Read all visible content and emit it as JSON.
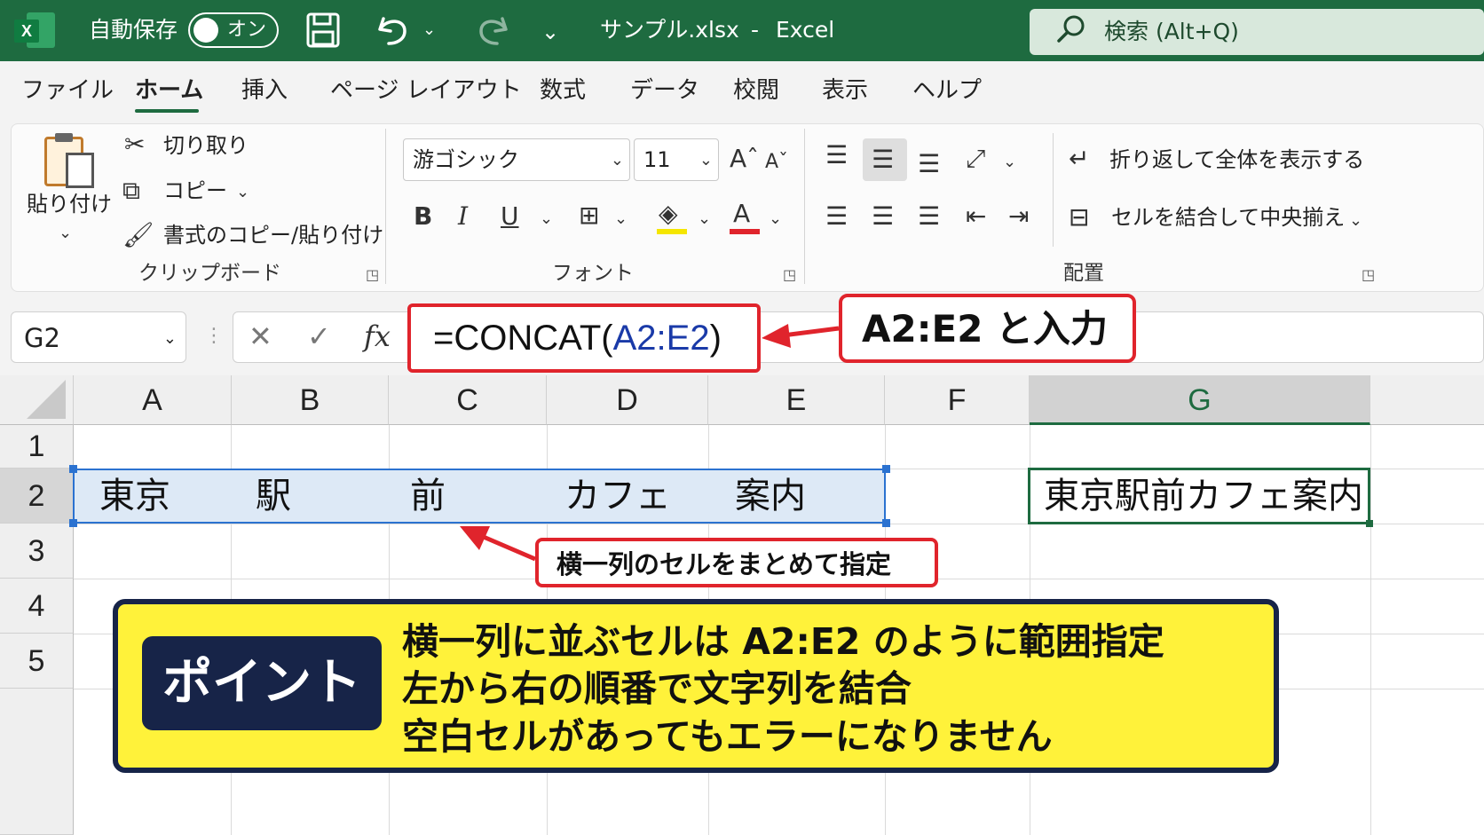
{
  "titlebar": {
    "app_icon": "X",
    "autosave_label": "自動保存",
    "autosave_toggle": "オン",
    "filename": "サンプル.xlsx",
    "separator": "-",
    "app_name": "Excel",
    "search_placeholder": "検索 (Alt+Q)",
    "icons": [
      "excel-logo-icon",
      "save-icon",
      "undo-icon",
      "redo-icon",
      "customize-icon",
      "search-icon"
    ]
  },
  "menu": {
    "tabs": [
      "ファイル",
      "ホーム",
      "挿入",
      "ページ レイアウト",
      "数式",
      "データ",
      "校閲",
      "表示",
      "ヘルプ"
    ],
    "active": "ホーム"
  },
  "ribbon": {
    "clipboard": {
      "paste": "貼り付け",
      "cut": "切り取り",
      "copy": "コピー",
      "format_painter": "書式のコピー/貼り付け",
      "group_label": "クリップボード"
    },
    "font": {
      "font_name": "游ゴシック",
      "font_size": "11",
      "bold": "B",
      "italic": "I",
      "underline": "U",
      "font_color_glyph": "A",
      "group_label": "フォント",
      "highlight_color": "#f5e600",
      "font_color": "#e0242c"
    },
    "alignment": {
      "wrap_text": "折り返して全体を表示する",
      "merge_center": "セルを結合して中央揃え",
      "group_label": "配置"
    }
  },
  "formula_bar": {
    "name_box": "G2",
    "cancel": "✕",
    "enter": "✓",
    "fx": "fx",
    "formula_prefix": "=CONCAT(",
    "formula_ref": "A2:E2",
    "formula_suffix": ")"
  },
  "sheet": {
    "columns": [
      "A",
      "B",
      "C",
      "D",
      "E",
      "F",
      "G"
    ],
    "selected_column": "G",
    "rows": [
      "1",
      "2",
      "3",
      "4",
      "5"
    ],
    "selected_row": "2",
    "row2": {
      "A": "東京",
      "B": "駅",
      "C": "前",
      "D": "カフェ",
      "E": "案内",
      "G": "東京駅前カフェ案内"
    }
  },
  "annotations": {
    "formula_callout": "A2:E2 と入力",
    "range_callout": "横一列のセルをまとめて指定",
    "point_tag": "ポイント",
    "point_lines": [
      "横一列に並ぶセルは A2:E2 のように範囲指定",
      "左から右の順番で文字列を結合",
      "空白セルがあってもエラーになりません"
    ],
    "accent_red": "#e0242c",
    "point_bg": "#fff23a",
    "point_navy": "#172448"
  }
}
